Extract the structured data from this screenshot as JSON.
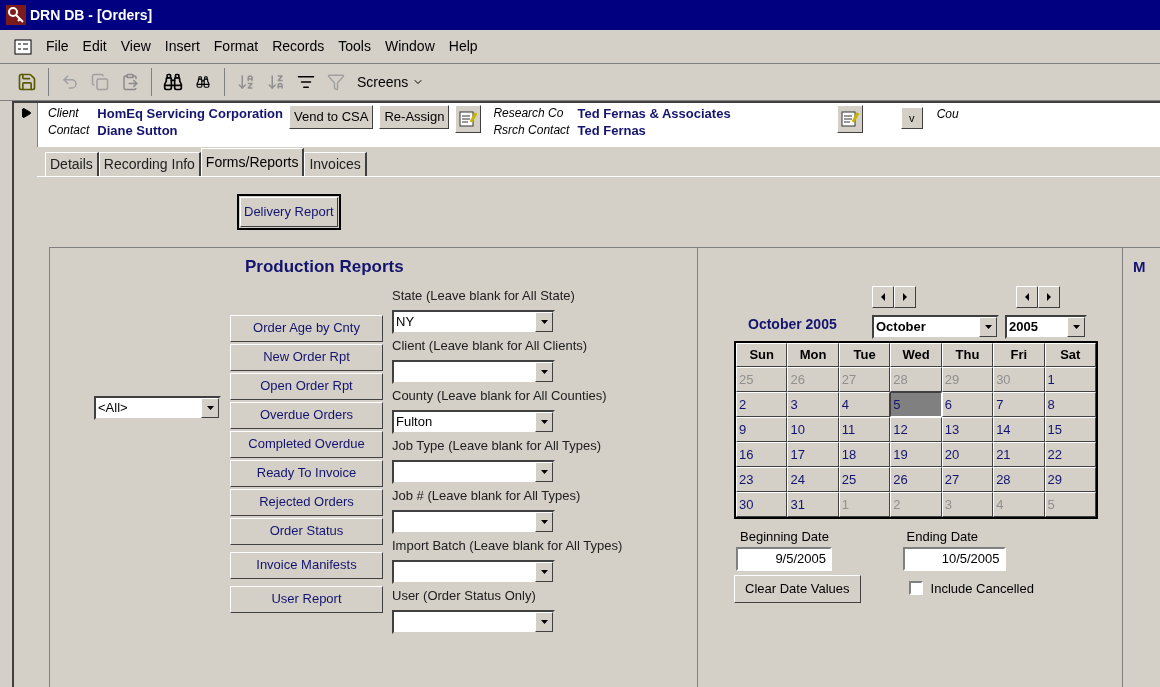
{
  "window": {
    "title": "DRN DB - [Orders]"
  },
  "menu": [
    "File",
    "Edit",
    "View",
    "Insert",
    "Format",
    "Records",
    "Tools",
    "Window",
    "Help"
  ],
  "toolbar": {
    "screens_label": "Screens"
  },
  "record": {
    "client_label": "Client",
    "client": "HomEq Servicing Corporation",
    "contact_label": "Contact",
    "contact": "Diane Sutton",
    "buttons": [
      "Vend to CSA",
      "Re-Assign"
    ],
    "research_co_label": "Research Co",
    "research_co": "Ted Fernas & Associates",
    "rsrch_contact_label": "Rsrch Contact",
    "rsrch_contact": "Ted Fernas",
    "v_button": "v",
    "cut_label": "Cou"
  },
  "tabs": [
    {
      "label": "Details",
      "selected": false
    },
    {
      "label": "Recording Info",
      "selected": false
    },
    {
      "label": "Forms/Reports",
      "selected": true
    },
    {
      "label": "Invoices",
      "selected": false
    }
  ],
  "delivery_button": "Delivery Report",
  "production": {
    "title": "Production Reports",
    "all_select": "<All>",
    "report_buttons": [
      "Order Age by Cnty",
      "New Order Rpt",
      "Open Order Rpt",
      "Overdue Orders",
      "Completed Overdue",
      "Ready To Invoice",
      "Rejected Orders",
      "Order Status",
      "Invoice Manifests",
      "User Report"
    ],
    "filters": [
      {
        "label": "State (Leave blank for All State)",
        "value": "NY"
      },
      {
        "label": "Client (Leave blank for All Clients)"
      },
      {
        "label": "County (Leave blank for All Counties)",
        "value": "Fulton"
      },
      {
        "label": "Job Type (Leave blank for All Types)"
      },
      {
        "label": "Job # (Leave blank for All Types)"
      },
      {
        "label": "Import Batch (Leave blank for All Types)"
      },
      {
        "label": "User (Order Status Only)"
      }
    ]
  },
  "calendar": {
    "caption": "October 2005",
    "month": "October",
    "year": "2005",
    "weekdays": [
      "Sun",
      "Mon",
      "Tue",
      "Wed",
      "Thu",
      "Fri",
      "Sat"
    ],
    "days": [
      {
        "label": "25",
        "muted": true,
        "selected": false
      },
      {
        "label": "26",
        "muted": true,
        "selected": false
      },
      {
        "label": "27",
        "muted": true,
        "selected": false
      },
      {
        "label": "28",
        "muted": true,
        "selected": false
      },
      {
        "label": "29",
        "muted": true,
        "selected": false
      },
      {
        "label": "30",
        "muted": true,
        "selected": false
      },
      {
        "label": "1",
        "muted": false,
        "selected": false
      },
      {
        "label": "2",
        "muted": false,
        "selected": false
      },
      {
        "label": "3",
        "muted": false,
        "selected": false
      },
      {
        "label": "4",
        "muted": false,
        "selected": false
      },
      {
        "label": "5",
        "muted": false,
        "selected": true
      },
      {
        "label": "6",
        "muted": false,
        "selected": false
      },
      {
        "label": "7",
        "muted": false,
        "selected": false
      },
      {
        "label": "8",
        "muted": false,
        "selected": false
      },
      {
        "label": "9",
        "muted": false,
        "selected": false
      },
      {
        "label": "10",
        "muted": false,
        "selected": false
      },
      {
        "label": "11",
        "muted": false,
        "selected": false
      },
      {
        "label": "12",
        "muted": false,
        "selected": false
      },
      {
        "label": "13",
        "muted": false,
        "selected": false
      },
      {
        "label": "14",
        "muted": false,
        "selected": false
      },
      {
        "label": "15",
        "muted": false,
        "selected": false
      },
      {
        "label": "16",
        "muted": false,
        "selected": false
      },
      {
        "label": "17",
        "muted": false,
        "selected": false
      },
      {
        "label": "18",
        "muted": false,
        "selected": false
      },
      {
        "label": "19",
        "muted": false,
        "selected": false
      },
      {
        "label": "20",
        "muted": false,
        "selected": false
      },
      {
        "label": "21",
        "muted": false,
        "selected": false
      },
      {
        "label": "22",
        "muted": false,
        "selected": false
      },
      {
        "label": "23",
        "muted": false,
        "selected": false
      },
      {
        "label": "24",
        "muted": false,
        "selected": false
      },
      {
        "label": "25",
        "muted": false,
        "selected": false
      },
      {
        "label": "26",
        "muted": false,
        "selected": false
      },
      {
        "label": "27",
        "muted": false,
        "selected": false
      },
      {
        "label": "28",
        "muted": false,
        "selected": false
      },
      {
        "label": "29",
        "muted": false,
        "selected": false
      },
      {
        "label": "30",
        "muted": false,
        "selected": false
      },
      {
        "label": "31",
        "muted": false,
        "selected": false
      },
      {
        "label": "1",
        "muted": true,
        "selected": false
      },
      {
        "label": "2",
        "muted": true,
        "selected": false
      },
      {
        "label": "3",
        "muted": true,
        "selected": false
      },
      {
        "label": "4",
        "muted": true,
        "selected": false
      },
      {
        "label": "5",
        "muted": true,
        "selected": false
      }
    ]
  },
  "dates": {
    "begin_label": "Beginning Date",
    "begin": "9/5/2005",
    "end_label": "Ending Date",
    "end": "10/5/2005",
    "clear_button": "Clear Date Values"
  },
  "include_cancelled": {
    "label": "Include Cancelled",
    "checked": false
  },
  "right_panel": {
    "heading": "M"
  }
}
